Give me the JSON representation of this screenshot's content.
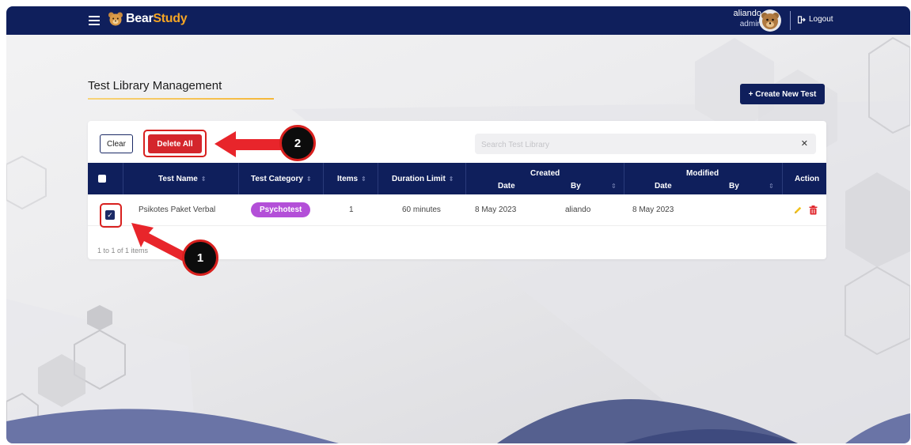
{
  "app": {
    "brand_part1": "Bear",
    "brand_part2": "Study",
    "user_name": "aliando",
    "user_role": "admin",
    "logout_label": "Logout"
  },
  "page": {
    "title": "Test Library Management",
    "create_label": "+ Create New Test"
  },
  "toolbar": {
    "clear_label": "Clear",
    "delete_all_label": "Delete All",
    "search_placeholder": "Search Test Library",
    "search_value": ""
  },
  "table": {
    "columns": {
      "test_name": "Test Name",
      "test_category": "Test Category",
      "items": "Items",
      "duration_limit": "Duration Limit",
      "created": "Created",
      "modified": "Modified",
      "date": "Date",
      "by": "By",
      "action": "Action"
    },
    "rows": [
      {
        "checked": true,
        "test_name": "Psikotes Paket Verbal",
        "test_category": "Psychotest",
        "items": "1",
        "duration_limit": "60 minutes",
        "created_date": "8 May 2023",
        "created_by": "aliando",
        "modified_date": "8 May 2023",
        "modified_by": ""
      }
    ],
    "footer": "1 to 1 of 1 items"
  },
  "annotations": {
    "step1": "1",
    "step2": "2"
  },
  "colors": {
    "navy": "#0f1f5c",
    "accent": "#f5a524",
    "danger": "#d4262c",
    "category_pill": "#b34fd8",
    "annotation_red": "#d8201e"
  }
}
